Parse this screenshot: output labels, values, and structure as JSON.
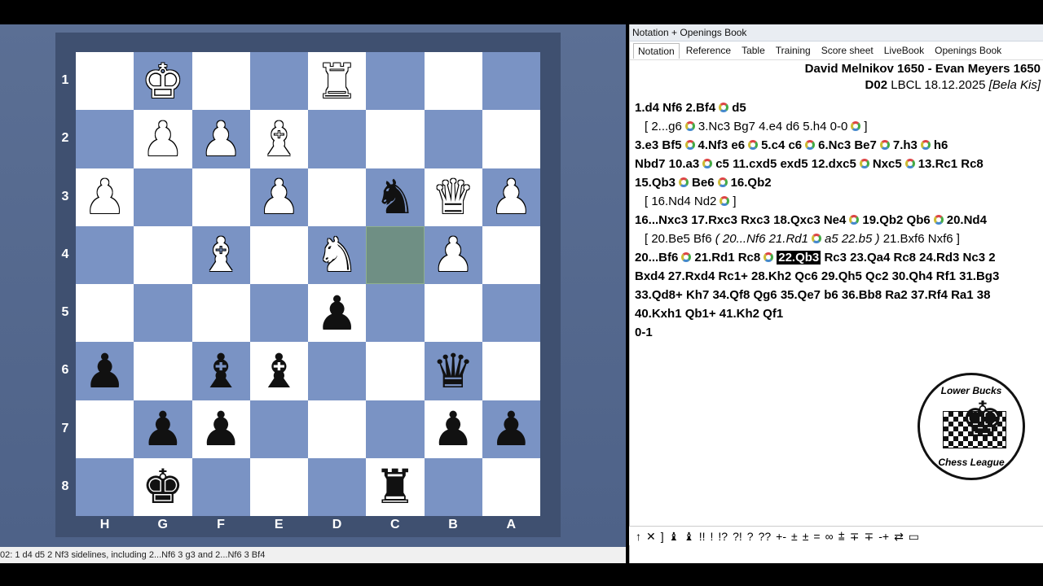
{
  "panel": {
    "title": "Notation + Openings Book",
    "tabs": [
      "Notation",
      "Reference",
      "Table",
      "Training",
      "Score sheet",
      "LiveBook",
      "Openings Book"
    ]
  },
  "game": {
    "players": "David Melnikov 1650 - Evan Meyers 1650",
    "eco": "D02",
    "event": "LBCL 18.12.2025",
    "annotator": "[Bela Kis]"
  },
  "moves": {
    "l1": "1.d4 Nf6 2.Bf4",
    "l1b": "d5",
    "l2a": "[ 2...g6",
    "l2b": "3.Nc3 Bg7 4.e4 d6 5.h4 0-0",
    "l2c": "]",
    "l3a": "3.e3 Bf5",
    "l3b": "4.Nf3 e6",
    "l3c": "5.c4 c6",
    "l3d": "6.Nc3 Be7",
    "l3e": "7.h3",
    "l3f": "h6",
    "l4a": "Nbd7 10.a3",
    "l4b": "c5 11.cxd5 exd5 12.dxc5",
    "l4c": "Nxc5",
    "l4d": "13.Rc1 Rc8",
    "l5a": "15.Qb3",
    "l5b": "Be6",
    "l5c": "16.Qb2",
    "l6a": "[ 16.Nd4 Nd2",
    "l6b": "]",
    "l7a": "16...Nxc3 17.Rxc3 Rxc3 18.Qxc3 Ne4",
    "l7b": "19.Qb2 Qb6",
    "l7c": "20.Nd4",
    "l8a": "[ 20.Be5 Bf6",
    "l8b": "( 20...Nf6 21.Rd1",
    "l8c": "a5 22.b5 )",
    "l8d": "21.Bxf6 Nxf6 ]",
    "l9a": "20...Bf6",
    "l9b": "21.Rd1 Rc8",
    "l9cur": "22.Qb3",
    "l9c": "Rc3 23.Qa4 Rc8 24.Rd3 Nc3 2",
    "l10": "Bxd4 27.Rxd4 Rc1+ 28.Kh2 Qc6 29.Qh5 Qc2 30.Qh4 Rf1 31.Bg3",
    "l11": "33.Qd8+ Kh7 34.Qf8 Qg6 35.Qe7 b6 36.Bb8 Ra2 37.Rf4 Ra1 38",
    "l12": "40.Kxh1 Qb1+ 41.Kh2 Qf1",
    "result": "0-1"
  },
  "logo": {
    "top": "Lower Bucks",
    "bottom": "Chess League"
  },
  "symbols": [
    "↑",
    "✕",
    "]",
    "♝",
    "♝",
    "!!",
    "!",
    "!?",
    "?!",
    "?",
    "??",
    "+-",
    "±",
    "±",
    "=",
    "∞",
    "⩲",
    "∓",
    "∓",
    "-+",
    "⇄",
    "▭"
  ],
  "status": "02: 1 d4 d5 2 Nf3 sidelines, including 2...Nf6 3 g3 and 2...Nf6 3 Bf4",
  "board": {
    "ranks": [
      "1",
      "2",
      "3",
      "4",
      "5",
      "6",
      "7",
      "8"
    ],
    "files": [
      "H",
      "G",
      "F",
      "E",
      "D",
      "C",
      "B",
      "A"
    ],
    "squares": [
      [
        "",
        "K",
        "",
        "",
        "R",
        "",
        "",
        ""
      ],
      [
        "",
        "P",
        "P",
        "B",
        "",
        "",
        "",
        ""
      ],
      [
        "P",
        "",
        "",
        "P",
        "",
        "n",
        "Q",
        "P"
      ],
      [
        "",
        "",
        "B",
        "",
        "N",
        "",
        "P",
        ""
      ],
      [
        "",
        "",
        "",
        "",
        "p",
        "",
        "",
        ""
      ],
      [
        "p",
        "",
        "b",
        "b",
        "",
        "",
        "q",
        ""
      ],
      [
        "",
        "p",
        "p",
        "",
        "",
        "",
        "p",
        "p"
      ],
      [
        "",
        "k",
        "",
        "",
        "",
        "r",
        "",
        ""
      ]
    ],
    "highlight": "3-5"
  }
}
